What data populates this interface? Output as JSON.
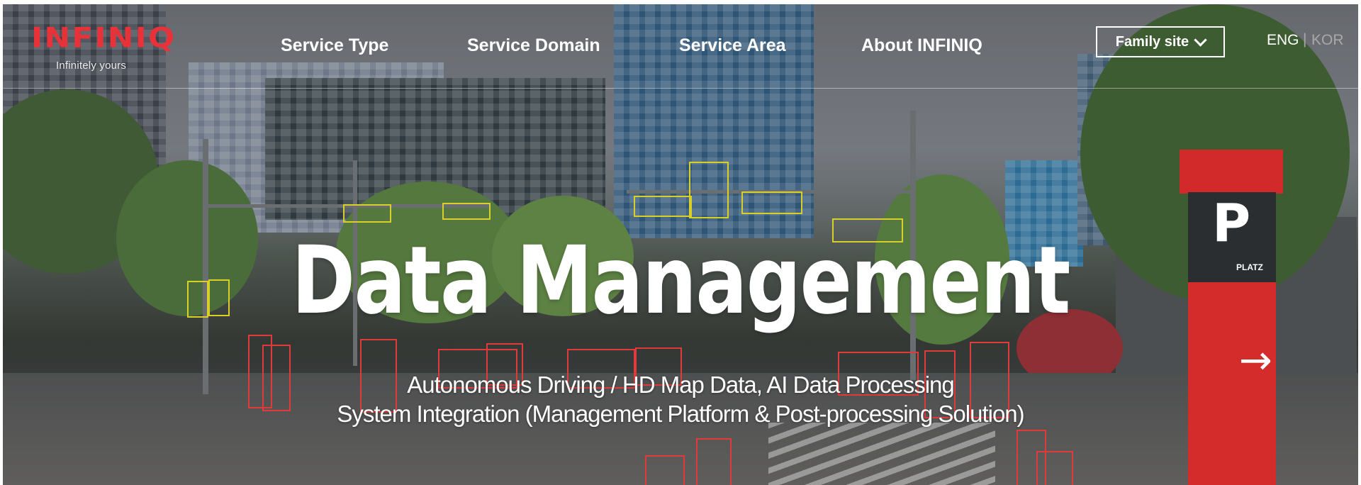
{
  "logo": {
    "word": "INFINIQ",
    "tagline": "Infinitely yours"
  },
  "nav": [
    {
      "label": "Service Type"
    },
    {
      "label": "Service Domain"
    },
    {
      "label": "Service Area"
    },
    {
      "label": "About INFINIQ"
    }
  ],
  "family_site": {
    "label": "Family site"
  },
  "languages": {
    "eng": "ENG",
    "separator": "|",
    "kor": "KOR"
  },
  "hero": {
    "title": "Data Management",
    "subtitle_line1": "Autonomous Driving / HD Map Data, AI Data Processing",
    "subtitle_line2": "System Integration (Management Platform & Post-processing Solution)"
  },
  "scene_signs": {
    "parking_letter": "P",
    "parking_label": "PLATZ",
    "arrow": "→"
  },
  "colors": {
    "brand_red": "#e8323a",
    "annotation_red": "#e03a3a",
    "annotation_yellow": "#d8cf28"
  }
}
